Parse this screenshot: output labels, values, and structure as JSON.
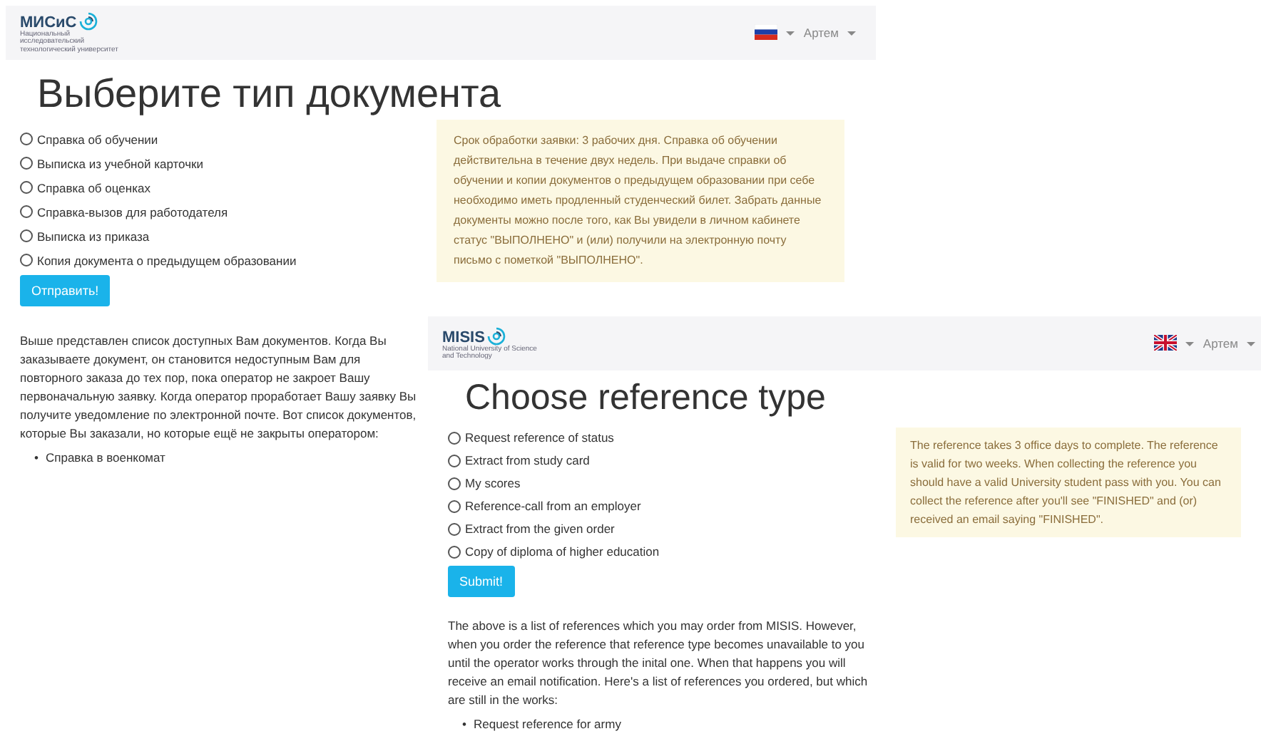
{
  "panels": [
    {
      "kind": "ru",
      "logo": "МИСиС",
      "logo_subtitle": "Национальный исследовательский технологический университет",
      "user": "Артем",
      "heading": "Выберите тип документа",
      "options": [
        {
          "label": "Справка об обучении",
          "selected": false
        },
        {
          "label": "Выписка из учебной карточки",
          "selected": false
        },
        {
          "label": "Справка об оценках",
          "selected": false
        },
        {
          "label": "Справка-вызов для работодателя",
          "selected": false
        },
        {
          "label": "Выписка из приказа",
          "selected": false
        },
        {
          "label": "Копия документа о предыдущем образовании",
          "selected": false
        }
      ],
      "submit": "Отправить!",
      "notice": "Срок обработки заявки: 3 рабочих дня. Справка об обучении действительна в течение двух недель. При выдаче справки об обучении и копии документов о предыдущем образовании при себе необходимо иметь продленный студенческий билет. Забрать данные документы можно после того, как Вы увидели в личном кабинете статус \"ВЫПОЛНЕНО\" и (или) получили на электронную почту письмо с пометкой \"ВЫПОЛНЕНО\".",
      "description": "Выше представлен список доступных Вам документов. Когда Вы заказываете документ, он становится недоступным Вам для повторного заказа до тех пор, пока оператор не закроет Вашу первоначальную заявку. Когда оператор проработает Вашу заявку Вы получите уведомление по электронной почте. Вот список документов, которые Вы заказали, но которые ещё не закрыты оператором:",
      "ordered": [
        {
          "marker": "•",
          "label": "Справка в военкомат"
        }
      ]
    },
    {
      "kind": "uk",
      "logo": "MISIS",
      "logo_subtitle": "National University of Science and Technology",
      "user": "Артем",
      "heading": "Choose reference type",
      "options": [
        {
          "label": "Request reference of status",
          "selected": false
        },
        {
          "label": "Extract from study card",
          "selected": false
        },
        {
          "label": "My scores",
          "selected": false
        },
        {
          "label": "Reference-call from an employer",
          "selected": false
        },
        {
          "label": "Extract from the given order",
          "selected": false
        },
        {
          "label": "Copy of diploma of higher education",
          "selected": false
        }
      ],
      "submit": "Submit!",
      "notice": "The reference takes 3 office days to complete. The reference is valid for two weeks. When collecting the reference you should have a valid University student pass with you. You can collect the reference after you'll see \"FINISHED\" and (or) received an email saying \"FINISHED\".",
      "description": "The above is a list of references which you may order from MISIS. However, when you order the reference that reference type becomes unavailable to you until the operator works through the inital one. When that happens you will receive an email notification. Here's a list of references you ordered, but which are still in the works:",
      "ordered": [
        {
          "marker": "•",
          "label": "Request reference for army"
        }
      ]
    }
  ]
}
